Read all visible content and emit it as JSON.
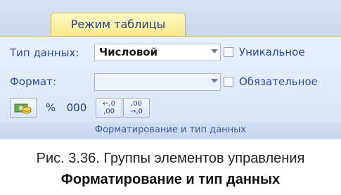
{
  "ribbon": {
    "tab_label": "Режим таблицы",
    "data_type": {
      "label": "Тип данных:",
      "value": "Числовой",
      "checkbox_label": "Уникальное",
      "checked": false
    },
    "format": {
      "label": "Формат:",
      "value": "",
      "checkbox_label": "Обязательное",
      "checked": false
    },
    "buttons": {
      "percent": "%",
      "thousands": "000",
      "increase_decimals_top": "←,0",
      "increase_decimals_bottom": ",00",
      "decrease_decimals_top": ",00",
      "decrease_decimals_bottom": "→,0"
    },
    "group_label": "Форматирование и тип данных"
  },
  "caption": {
    "line1": "Рис. 3.36. Группы элементов управления",
    "line2": "Форматирование и тип данных"
  }
}
